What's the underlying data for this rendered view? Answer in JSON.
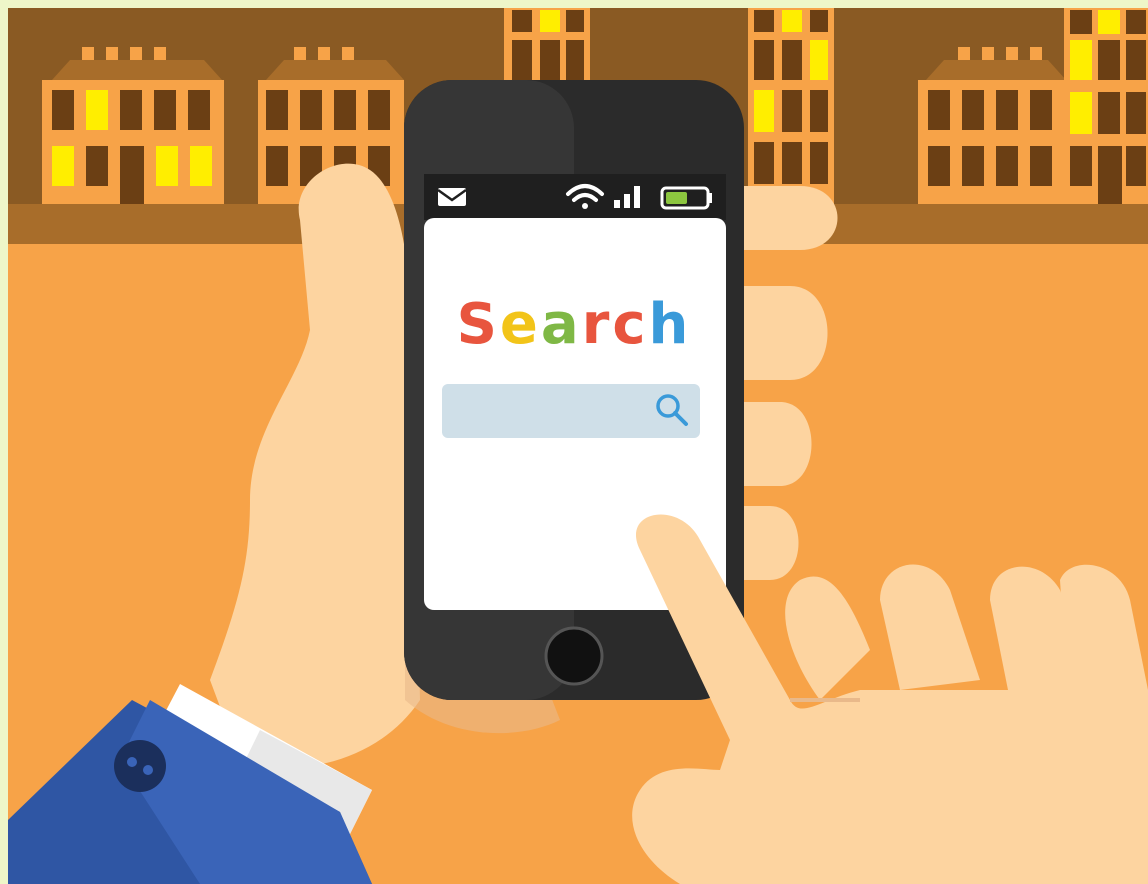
{
  "search_title": {
    "letters": [
      {
        "char": "S",
        "color": "#e8553e"
      },
      {
        "char": "e",
        "color": "#f2c419"
      },
      {
        "char": "a",
        "color": "#7fb845"
      },
      {
        "char": "r",
        "color": "#e8553e"
      },
      {
        "char": "c",
        "color": "#e8553e"
      },
      {
        "char": "h",
        "color": "#3a9ad9"
      }
    ]
  },
  "search_box": {
    "value": "",
    "placeholder": ""
  },
  "status_bar": {
    "icons": [
      "mail-icon",
      "wifi-icon",
      "signal-icon",
      "battery-icon"
    ],
    "battery_level": 0.55
  },
  "colors": {
    "background": "#f7a348",
    "buildings": "#8a5a23",
    "windows_lit": "#ffee00",
    "phone_body": "#2b2b2b",
    "screen": "#ffffff",
    "skin": "#fdd4a0",
    "sleeve": "#2f56a4",
    "search_box": "#cfdfe8",
    "search_icon": "#3a9ad9",
    "battery": "#8cc63f"
  }
}
